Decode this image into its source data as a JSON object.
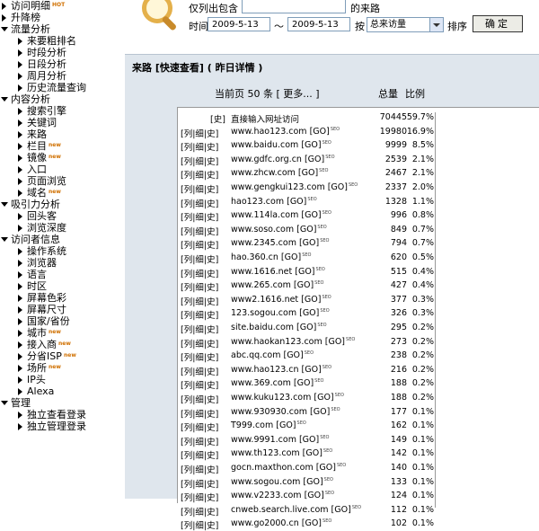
{
  "sidebar": {
    "items": [
      {
        "label": "访问明细",
        "level": 0,
        "badge": "HOT"
      },
      {
        "label": "升降榜",
        "level": 0
      },
      {
        "label": "流量分析",
        "level": 0,
        "open": true
      },
      {
        "label": "来要粗排名",
        "level": 1
      },
      {
        "label": "时段分析",
        "level": 1
      },
      {
        "label": "日段分析",
        "level": 1
      },
      {
        "label": "周月分析",
        "level": 1
      },
      {
        "label": "历史流量查询",
        "level": 1
      },
      {
        "label": "内容分析",
        "level": 0,
        "open": true
      },
      {
        "label": "搜索引擎",
        "level": 1
      },
      {
        "label": "关键词",
        "level": 1
      },
      {
        "label": "来路",
        "level": 1
      },
      {
        "label": "栏目",
        "level": 1,
        "badge": "new"
      },
      {
        "label": "镜像",
        "level": 1,
        "badge": "new"
      },
      {
        "label": "入口",
        "level": 1
      },
      {
        "label": "页面浏览",
        "level": 1
      },
      {
        "label": "域名",
        "level": 1,
        "badge": "new"
      },
      {
        "label": "吸引力分析",
        "level": 0,
        "open": true
      },
      {
        "label": "回头客",
        "level": 1
      },
      {
        "label": "浏览深度",
        "level": 1
      },
      {
        "label": "访问者信息",
        "level": 0,
        "open": true
      },
      {
        "label": "操作系统",
        "level": 1
      },
      {
        "label": "浏览器",
        "level": 1
      },
      {
        "label": "语言",
        "level": 1
      },
      {
        "label": "时区",
        "level": 1
      },
      {
        "label": "屏幕色彩",
        "level": 1
      },
      {
        "label": "屏幕尺寸",
        "level": 1
      },
      {
        "label": "国家/省份",
        "level": 1
      },
      {
        "label": "城市",
        "level": 1,
        "badge": "new"
      },
      {
        "label": "接入商",
        "level": 1,
        "badge": "new"
      },
      {
        "label": "分省ISP",
        "level": 1,
        "badge": "new"
      },
      {
        "label": "场所",
        "level": 1,
        "badge": "new"
      },
      {
        "label": "IP头",
        "level": 1
      },
      {
        "label": "Alexa",
        "level": 1
      },
      {
        "label": "管理",
        "level": 0,
        "open": true
      },
      {
        "label": "独立查看登录",
        "level": 1
      },
      {
        "label": "独立管理登录",
        "level": 1
      }
    ]
  },
  "search": {
    "filter_label": "仅列出包含",
    "filter_value": "",
    "filter_suffix": "的来路",
    "time_label": "时间",
    "date_from": "2009-5-13",
    "tilde": "～",
    "date_to": "2009-5-13",
    "by_label": "按",
    "sort_select": "总来访量",
    "order_label": "排序",
    "confirm_label": "确定"
  },
  "main": {
    "title": "来路 [快速查看] ( 昨日详情 )",
    "page_info": "当前页 50 条 [ 更多... ]",
    "col_total": "总量",
    "col_ratio": "比例"
  },
  "rows": [
    {
      "tags": "[史]",
      "source": "直接输入网址访问",
      "count": "70445",
      "pct": "59.7%",
      "frac": 0.597,
      "direct": true
    },
    {
      "tags": "[列|细|史]",
      "source": "www.hao123.com [GO]",
      "count": "19980",
      "pct": "16.9%",
      "frac": 0.169,
      "sup": "SEO"
    },
    {
      "tags": "[列|细|史]",
      "source": "www.baidu.com [GO]",
      "count": "9999",
      "pct": "8.5%",
      "frac": 0.085,
      "sup": "SEO"
    },
    {
      "tags": "[列|细|史]",
      "source": "www.gdfc.org.cn [GO]",
      "count": "2539",
      "pct": "2.1%",
      "frac": 0.021,
      "sup": "SEO"
    },
    {
      "tags": "[列|细|史]",
      "source": "www.zhcw.com [GO]",
      "count": "2467",
      "pct": "2.1%",
      "frac": 0.021,
      "sup": "SEO"
    },
    {
      "tags": "[列|细|史]",
      "source": "www.gengkui123.com [GO]",
      "count": "2337",
      "pct": "2.0%",
      "frac": 0.02,
      "sup": "SEO"
    },
    {
      "tags": "[列|细|史]",
      "source": "hao123.com [GO]",
      "count": "1328",
      "pct": "1.1%",
      "frac": 0.011,
      "sup": "SEO"
    },
    {
      "tags": "[列|细|史]",
      "source": "www.114la.com [GO]",
      "count": "996",
      "pct": "0.8%",
      "frac": 0.008,
      "sup": "SEO"
    },
    {
      "tags": "[列|细|史]",
      "source": "www.soso.com [GO]",
      "count": "849",
      "pct": "0.7%",
      "frac": 0.007,
      "sup": "SEO"
    },
    {
      "tags": "[列|细|史]",
      "source": "www.2345.com [GO]",
      "count": "794",
      "pct": "0.7%",
      "frac": 0.007,
      "sup": "SEO"
    },
    {
      "tags": "[列|细|史]",
      "source": "hao.360.cn [GO]",
      "count": "620",
      "pct": "0.5%",
      "frac": 0.005,
      "sup": "SEO"
    },
    {
      "tags": "[列|细|史]",
      "source": "www.1616.net [GO]",
      "count": "515",
      "pct": "0.4%",
      "frac": 0.004,
      "sup": "SEO"
    },
    {
      "tags": "[列|细|史]",
      "source": "www.265.com [GO]",
      "count": "427",
      "pct": "0.4%",
      "frac": 0.004,
      "sup": "SEO"
    },
    {
      "tags": "[列|细|史]",
      "source": "www2.1616.net [GO]",
      "count": "377",
      "pct": "0.3%",
      "frac": 0.003,
      "sup": "SEO"
    },
    {
      "tags": "[列|细|史]",
      "source": "123.sogou.com [GO]",
      "count": "326",
      "pct": "0.3%",
      "frac": 0.003,
      "sup": "SEO"
    },
    {
      "tags": "[列|细|史]",
      "source": "site.baidu.com [GO]",
      "count": "295",
      "pct": "0.2%",
      "frac": 0.002,
      "sup": "SEO"
    },
    {
      "tags": "[列|细|史]",
      "source": "www.haokan123.com [GO]",
      "count": "273",
      "pct": "0.2%",
      "frac": 0.002,
      "sup": "SEO"
    },
    {
      "tags": "[列|细|史]",
      "source": "abc.qq.com [GO]",
      "count": "238",
      "pct": "0.2%",
      "frac": 0.002,
      "sup": "SEO"
    },
    {
      "tags": "[列|细|史]",
      "source": "www.hao123.cn [GO]",
      "count": "216",
      "pct": "0.2%",
      "frac": 0.002,
      "sup": "SEO"
    },
    {
      "tags": "[列|细|史]",
      "source": "www.369.com [GO]",
      "count": "188",
      "pct": "0.2%",
      "frac": 0.002,
      "sup": "SEO"
    },
    {
      "tags": "[列|细|史]",
      "source": "www.kuku123.com [GO]",
      "count": "188",
      "pct": "0.2%",
      "frac": 0.002,
      "sup": "SEO"
    },
    {
      "tags": "[列|细|史]",
      "source": "www.930930.com [GO]",
      "count": "177",
      "pct": "0.1%",
      "frac": 0.001,
      "sup": "SEO"
    },
    {
      "tags": "[列|细|史]",
      "source": "T999.com [GO]",
      "count": "162",
      "pct": "0.1%",
      "frac": 0.001,
      "sup": "SEO"
    },
    {
      "tags": "[列|细|史]",
      "source": "www.9991.com [GO]",
      "count": "149",
      "pct": "0.1%",
      "frac": 0.001,
      "sup": "SEO"
    },
    {
      "tags": "[列|细|史]",
      "source": "www.th123.com [GO]",
      "count": "142",
      "pct": "0.1%",
      "frac": 0.001,
      "sup": "SEO"
    },
    {
      "tags": "[列|细|史]",
      "source": "gocn.maxthon.com [GO]",
      "count": "140",
      "pct": "0.1%",
      "frac": 0.001,
      "sup": "SEO"
    },
    {
      "tags": "[列|细|史]",
      "source": "www.sogou.com [GO]",
      "count": "133",
      "pct": "0.1%",
      "frac": 0.001,
      "sup": "SEO"
    },
    {
      "tags": "[列|细|史]",
      "source": "www.v2233.com [GO]",
      "count": "124",
      "pct": "0.1%",
      "frac": 0.001,
      "sup": "SEO"
    },
    {
      "tags": "[列|细|史]",
      "source": "cnweb.search.live.com [GO]",
      "count": "112",
      "pct": "0.1%",
      "frac": 0.001,
      "sup": "SEO"
    },
    {
      "tags": "[列|细|史]",
      "source": "www.go2000.cn [GO]",
      "count": "102",
      "pct": "0.1%",
      "frac": 0.001,
      "sup": "SEO"
    }
  ],
  "colors": {
    "bar": "#1e3d78",
    "badge": "#d07000",
    "panel": "#dfe6ed"
  },
  "icons": {
    "search": "magnifier-icon",
    "expand": "triangle-icon"
  }
}
